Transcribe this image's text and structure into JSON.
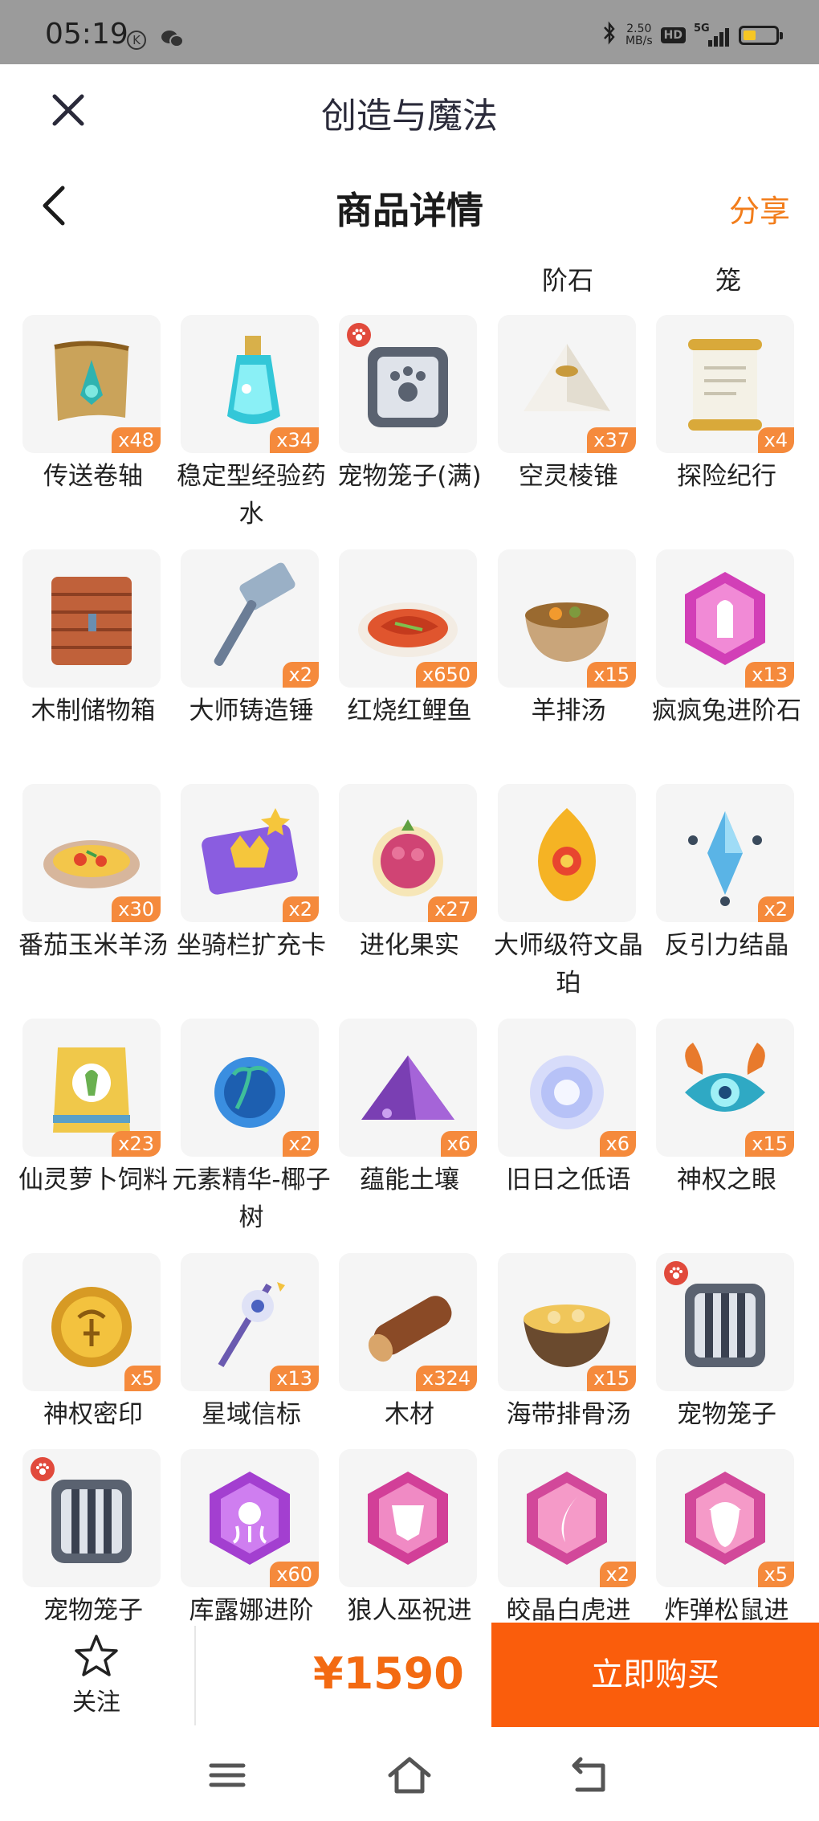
{
  "status_bar": {
    "time": "05:19",
    "k_badge": "K",
    "net_speed_value": "2.50",
    "net_speed_unit": "MB/s",
    "hd": "HD",
    "signal": "5G",
    "battery_percent": 40
  },
  "header": {
    "app_title": "创造与魔法",
    "page_title": "商品详情",
    "share_label": "分享"
  },
  "items_area": {
    "prev_labels": [
      "阶石",
      "笼"
    ],
    "items": [
      {
        "name": "传送卷轴",
        "qty": "x48",
        "icon": "scroll-icon"
      },
      {
        "name": "稳定型经验药水",
        "qty": "x34",
        "icon": "potion-icon"
      },
      {
        "name": "宠物笼子(满)",
        "qty": "",
        "icon": "pet-cage-full-icon",
        "pet": true
      },
      {
        "name": "空灵棱锥",
        "qty": "x37",
        "icon": "pyramid-icon"
      },
      {
        "name": "探险纪行",
        "qty": "x4",
        "icon": "journal-scroll-icon"
      },
      {
        "name": "木制储物箱",
        "qty": "",
        "icon": "wooden-chest-icon"
      },
      {
        "name": "大师铸造锤",
        "qty": "x2",
        "icon": "hammer-icon"
      },
      {
        "name": "红烧红鲤鱼",
        "qty": "x650",
        "icon": "fish-dish-icon"
      },
      {
        "name": "羊排汤",
        "qty": "x15",
        "icon": "soup-bowl-icon"
      },
      {
        "name": "疯疯兔进阶石",
        "qty": "x13",
        "icon": "rabbit-gem-icon"
      },
      {
        "name": "番茄玉米羊汤",
        "qty": "x30",
        "icon": "tomato-soup-icon"
      },
      {
        "name": "坐骑栏扩充卡",
        "qty": "x2",
        "icon": "crown-card-icon"
      },
      {
        "name": "进化果实",
        "qty": "x27",
        "icon": "evolution-fruit-icon"
      },
      {
        "name": "大师级符文晶珀",
        "qty": "",
        "icon": "rune-amber-icon"
      },
      {
        "name": "反引力结晶",
        "qty": "x2",
        "icon": "crystal-icon"
      },
      {
        "name": "仙灵萝卜饲料",
        "qty": "x23",
        "icon": "feed-bag-icon"
      },
      {
        "name": "元素精华-椰子树",
        "qty": "x2",
        "icon": "element-orb-icon"
      },
      {
        "name": "蕴能土壤",
        "qty": "x6",
        "icon": "soil-pile-icon"
      },
      {
        "name": "旧日之低语",
        "qty": "x6",
        "icon": "whisper-orb-icon"
      },
      {
        "name": "神权之眼",
        "qty": "x15",
        "icon": "eye-emblem-icon"
      },
      {
        "name": "神权密印",
        "qty": "x5",
        "icon": "seal-coin-icon"
      },
      {
        "name": "星域信标",
        "qty": "x13",
        "icon": "star-beacon-icon"
      },
      {
        "name": "木材",
        "qty": "x324",
        "icon": "wood-log-icon"
      },
      {
        "name": "海带排骨汤",
        "qty": "x15",
        "icon": "kelp-soup-icon"
      },
      {
        "name": "宠物笼子",
        "qty": "",
        "icon": "pet-cage-icon",
        "pet": true
      },
      {
        "name": "宠物笼子",
        "qty": "",
        "icon": "pet-cage-icon",
        "pet": true
      },
      {
        "name": "库露娜进阶",
        "qty": "x60",
        "icon": "octopus-gem-icon"
      },
      {
        "name": "狼人巫祝进",
        "qty": "",
        "icon": "mask-gem-icon"
      },
      {
        "name": "皎晶白虎进",
        "qty": "x2",
        "icon": "claw-gem-icon"
      },
      {
        "name": "炸弹松鼠进",
        "qty": "x5",
        "icon": "acorn-gem-icon"
      }
    ]
  },
  "action_bar": {
    "follow_label": "关注",
    "price": "¥1590",
    "buy_label": "立即购买"
  },
  "nav_bar": {
    "menu": "menu-icon",
    "home": "home-icon",
    "back": "back-icon"
  },
  "colors": {
    "accent_orange": "#fa5d0c",
    "price_orange": "#f36a12",
    "share_orange": "#f27d1b",
    "qty_badge": "#f58a3c",
    "status_bar_bg": "#9b9b9b"
  }
}
